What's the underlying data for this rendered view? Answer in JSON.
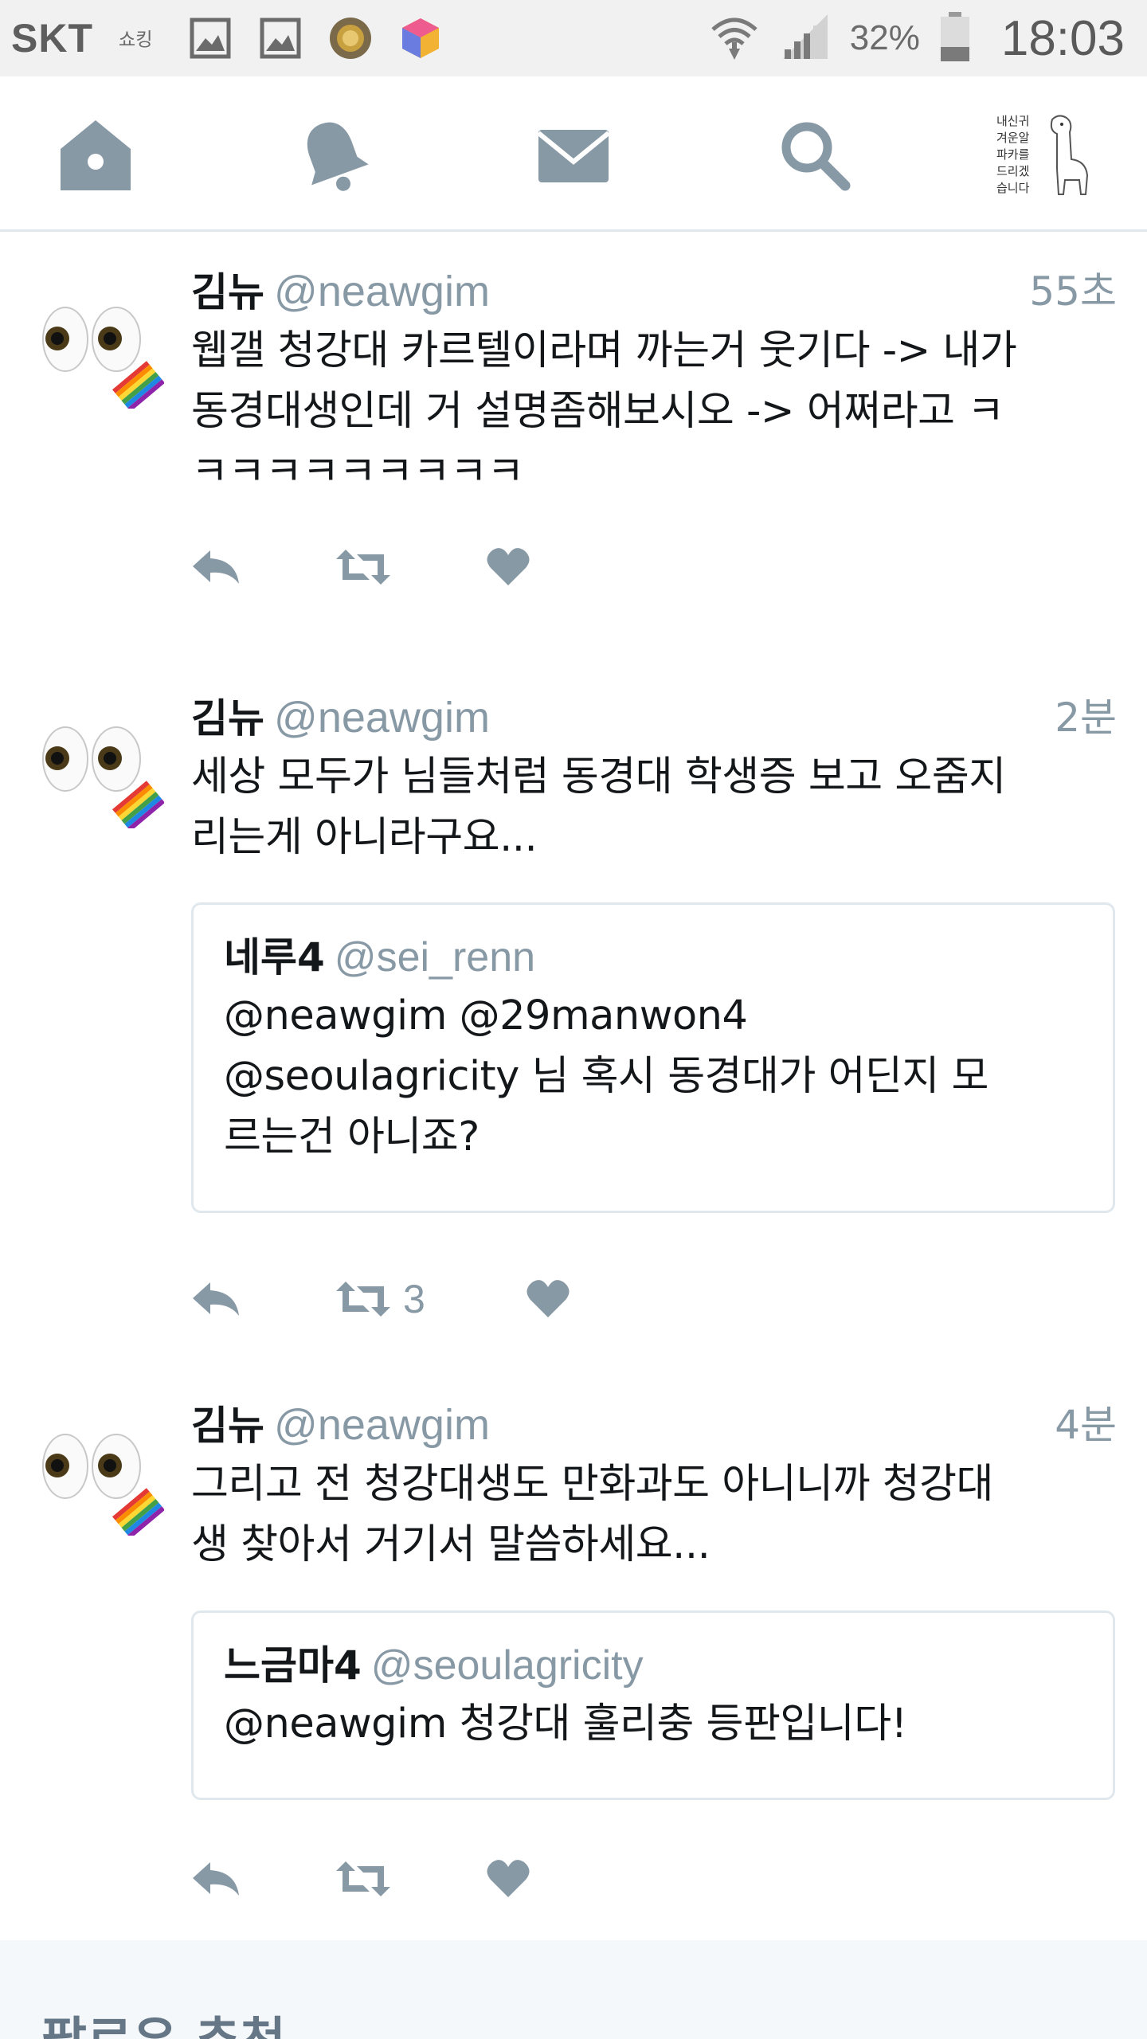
{
  "status_bar": {
    "carrier": "SKT",
    "battery_percent": "32%",
    "time": "18:03",
    "icons": [
      "shopping-app-icon",
      "gallery-icon",
      "gallery-icon",
      "medal-app-icon",
      "cube-app-icon",
      "wifi-icon",
      "signal-icon",
      "battery-icon"
    ]
  },
  "nav": {
    "items": [
      "home-icon",
      "notifications-icon",
      "messages-icon",
      "search-icon",
      "profile-avatar"
    ],
    "avatar_text": [
      "내신귀",
      "겨운알",
      "파카를",
      "드리겠",
      "습니다"
    ]
  },
  "tweets": [
    {
      "name": "김뉴",
      "handle": "@neawgim",
      "time": "55초",
      "text_lines": [
        "웹갤 청강대 카르텔이라며 까는거 웃기다 -> 내가",
        "동경대생인데 거 설명좀해보시오 -> 어쩌라고 ㅋ",
        "ㅋㅋㅋㅋㅋㅋㅋㅋㅋ"
      ],
      "retweet_count": "",
      "quote": null
    },
    {
      "name": "김뉴",
      "handle": "@neawgim",
      "time": "2분",
      "text_lines": [
        "세상 모두가 님들처럼 동경대 학생증 보고 오줌지",
        "리는게 아니라구요..."
      ],
      "retweet_count": "3",
      "quote": {
        "name": "네루4",
        "handle": "@sei_renn",
        "text_lines": [
          "@neawgim @29manwon4",
          "@seoulagricity 님 혹시 동경대가 어딘지 모",
          "르는건 아니죠?"
        ]
      }
    },
    {
      "name": "김뉴",
      "handle": "@neawgim",
      "time": "4분",
      "text_lines": [
        "그리고 전 청강대생도 만화과도 아니니까 청강대",
        "생 찾아서 거기서 말씀하세요..."
      ],
      "retweet_count": "",
      "quote": {
        "name": "느금마4",
        "handle": "@seoulagricity",
        "text_lines": [
          "@neawgim 청강대 훌리충 등판입니다!"
        ]
      }
    }
  ],
  "bottom": {
    "title": "팔로우 추천"
  },
  "colors": {
    "icon_gray": "#8899a6",
    "border": "#e1e8ed",
    "text": "#14171a"
  }
}
